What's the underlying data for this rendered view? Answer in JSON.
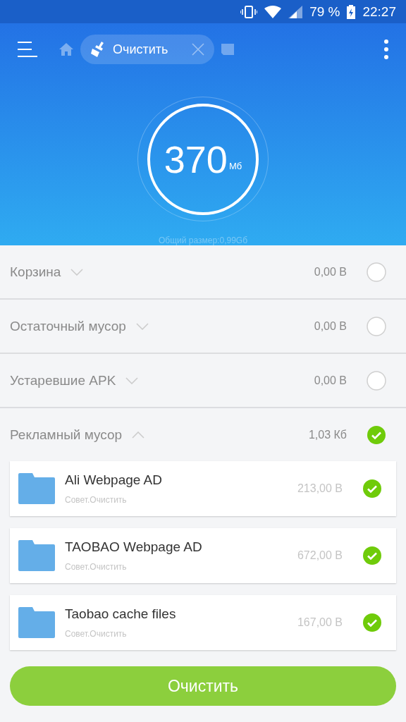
{
  "status_bar": {
    "battery": "79 %",
    "time": "22:27"
  },
  "toolbar": {
    "tab": {
      "label": "Очистить"
    }
  },
  "gauge": {
    "value": "370",
    "unit": "Мб",
    "total": "Общий размер:0,99Gб"
  },
  "categories": [
    {
      "name": "Корзина",
      "size": "0,00 B",
      "expanded": false,
      "checked": false
    },
    {
      "name": "Остаточный мусор",
      "size": "0,00 B",
      "expanded": false,
      "checked": false
    },
    {
      "name": "Устаревшие APK",
      "size": "0,00 B",
      "expanded": false,
      "checked": false
    },
    {
      "name": "Рекламный мусор",
      "size": "1,03 Кб",
      "expanded": true,
      "checked": true,
      "items": [
        {
          "name": "Ali Webpage AD",
          "hint": "Совет.Очистить",
          "size": "213,00 B",
          "checked": true
        },
        {
          "name": "TAOBAO Webpage AD",
          "hint": "Совет.Очистить",
          "size": "672,00 B",
          "checked": true
        },
        {
          "name": "Taobao cache files",
          "hint": "Совет.Очистить",
          "size": "167,00 B",
          "checked": true
        }
      ]
    }
  ],
  "clean_button": "Очистить"
}
